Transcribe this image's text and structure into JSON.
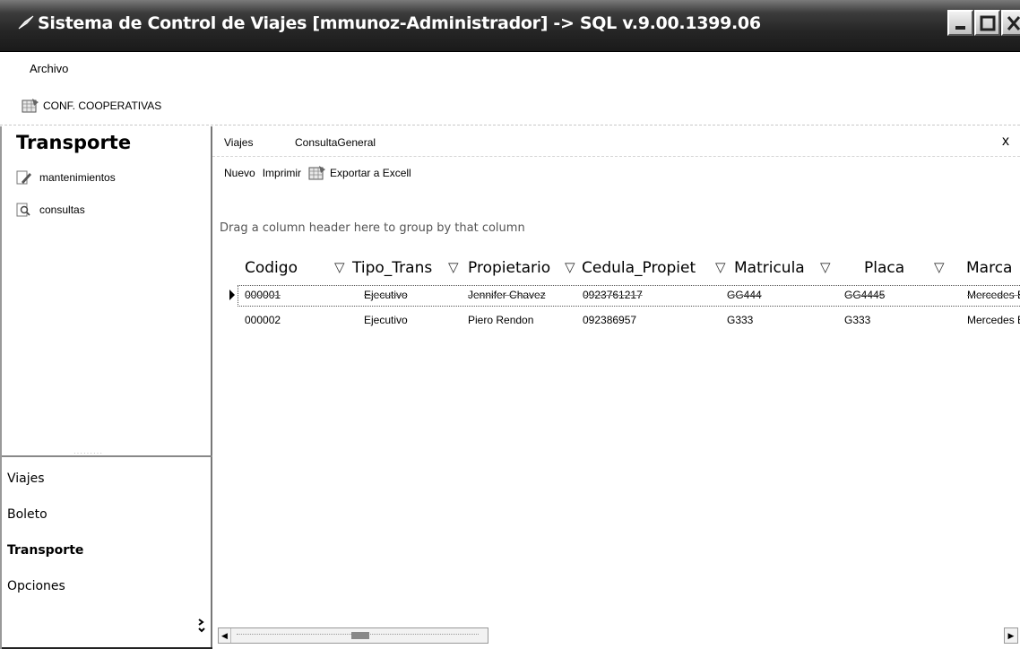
{
  "window": {
    "title": "Sistema de Control de Viajes [mmunoz-Administrador] -> SQL v.9.00.1399.06"
  },
  "menu": {
    "archivo_label": "Archivo"
  },
  "toolbar": {
    "conf_label": "CONF. COOPERATIVAS"
  },
  "sidebar": {
    "header": "Transporte",
    "items": [
      {
        "label": "mantenimientos",
        "icon": "pencil-document-icon"
      },
      {
        "label": "consultas",
        "icon": "magnifier-document-icon"
      }
    ],
    "sections": [
      {
        "label": "Viajes",
        "active": false
      },
      {
        "label": "Boleto",
        "active": false
      },
      {
        "label": "Transporte",
        "active": true
      },
      {
        "label": "Opciones",
        "active": false
      }
    ]
  },
  "tabs": [
    {
      "label": "Viajes"
    },
    {
      "label": "ConsultaGeneral"
    }
  ],
  "tab_close": "x",
  "actions": {
    "nuevo": "Nuevo",
    "imprimir": "Imprimir",
    "exportar": "Exportar a Excell"
  },
  "grid": {
    "group_hint": "Drag a column header here to group by that column",
    "columns": [
      "Codigo",
      "Tipo_Trans",
      "Propietario",
      "Cedula_Propiet",
      "Matricula",
      "Placa",
      "Marca"
    ],
    "filter_glyph": "▽",
    "rows": [
      [
        "000001",
        "Ejecutivo",
        "Jennifer Chavez",
        "0923761217",
        "GG444",
        "GG4445",
        "Mercedes B"
      ],
      [
        "000002",
        "Ejecutivo",
        "Piero Rendon",
        "092386957",
        "G333",
        "G333",
        "Mercedes B"
      ]
    ],
    "selected_row": 0
  },
  "colors": {
    "titlebar": "#262626",
    "title_text": "#ffffff"
  }
}
